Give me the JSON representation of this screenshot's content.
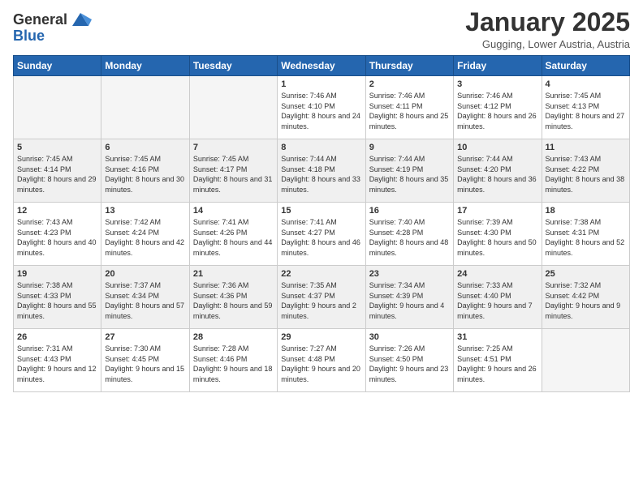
{
  "header": {
    "logo_general": "General",
    "logo_blue": "Blue",
    "month": "January 2025",
    "location": "Gugging, Lower Austria, Austria"
  },
  "weekdays": [
    "Sunday",
    "Monday",
    "Tuesday",
    "Wednesday",
    "Thursday",
    "Friday",
    "Saturday"
  ],
  "weeks": [
    [
      {
        "day": "",
        "info": ""
      },
      {
        "day": "",
        "info": ""
      },
      {
        "day": "",
        "info": ""
      },
      {
        "day": "1",
        "info": "Sunrise: 7:46 AM\nSunset: 4:10 PM\nDaylight: 8 hours and 24 minutes."
      },
      {
        "day": "2",
        "info": "Sunrise: 7:46 AM\nSunset: 4:11 PM\nDaylight: 8 hours and 25 minutes."
      },
      {
        "day": "3",
        "info": "Sunrise: 7:46 AM\nSunset: 4:12 PM\nDaylight: 8 hours and 26 minutes."
      },
      {
        "day": "4",
        "info": "Sunrise: 7:45 AM\nSunset: 4:13 PM\nDaylight: 8 hours and 27 minutes."
      }
    ],
    [
      {
        "day": "5",
        "info": "Sunrise: 7:45 AM\nSunset: 4:14 PM\nDaylight: 8 hours and 29 minutes."
      },
      {
        "day": "6",
        "info": "Sunrise: 7:45 AM\nSunset: 4:16 PM\nDaylight: 8 hours and 30 minutes."
      },
      {
        "day": "7",
        "info": "Sunrise: 7:45 AM\nSunset: 4:17 PM\nDaylight: 8 hours and 31 minutes."
      },
      {
        "day": "8",
        "info": "Sunrise: 7:44 AM\nSunset: 4:18 PM\nDaylight: 8 hours and 33 minutes."
      },
      {
        "day": "9",
        "info": "Sunrise: 7:44 AM\nSunset: 4:19 PM\nDaylight: 8 hours and 35 minutes."
      },
      {
        "day": "10",
        "info": "Sunrise: 7:44 AM\nSunset: 4:20 PM\nDaylight: 8 hours and 36 minutes."
      },
      {
        "day": "11",
        "info": "Sunrise: 7:43 AM\nSunset: 4:22 PM\nDaylight: 8 hours and 38 minutes."
      }
    ],
    [
      {
        "day": "12",
        "info": "Sunrise: 7:43 AM\nSunset: 4:23 PM\nDaylight: 8 hours and 40 minutes."
      },
      {
        "day": "13",
        "info": "Sunrise: 7:42 AM\nSunset: 4:24 PM\nDaylight: 8 hours and 42 minutes."
      },
      {
        "day": "14",
        "info": "Sunrise: 7:41 AM\nSunset: 4:26 PM\nDaylight: 8 hours and 44 minutes."
      },
      {
        "day": "15",
        "info": "Sunrise: 7:41 AM\nSunset: 4:27 PM\nDaylight: 8 hours and 46 minutes."
      },
      {
        "day": "16",
        "info": "Sunrise: 7:40 AM\nSunset: 4:28 PM\nDaylight: 8 hours and 48 minutes."
      },
      {
        "day": "17",
        "info": "Sunrise: 7:39 AM\nSunset: 4:30 PM\nDaylight: 8 hours and 50 minutes."
      },
      {
        "day": "18",
        "info": "Sunrise: 7:38 AM\nSunset: 4:31 PM\nDaylight: 8 hours and 52 minutes."
      }
    ],
    [
      {
        "day": "19",
        "info": "Sunrise: 7:38 AM\nSunset: 4:33 PM\nDaylight: 8 hours and 55 minutes."
      },
      {
        "day": "20",
        "info": "Sunrise: 7:37 AM\nSunset: 4:34 PM\nDaylight: 8 hours and 57 minutes."
      },
      {
        "day": "21",
        "info": "Sunrise: 7:36 AM\nSunset: 4:36 PM\nDaylight: 8 hours and 59 minutes."
      },
      {
        "day": "22",
        "info": "Sunrise: 7:35 AM\nSunset: 4:37 PM\nDaylight: 9 hours and 2 minutes."
      },
      {
        "day": "23",
        "info": "Sunrise: 7:34 AM\nSunset: 4:39 PM\nDaylight: 9 hours and 4 minutes."
      },
      {
        "day": "24",
        "info": "Sunrise: 7:33 AM\nSunset: 4:40 PM\nDaylight: 9 hours and 7 minutes."
      },
      {
        "day": "25",
        "info": "Sunrise: 7:32 AM\nSunset: 4:42 PM\nDaylight: 9 hours and 9 minutes."
      }
    ],
    [
      {
        "day": "26",
        "info": "Sunrise: 7:31 AM\nSunset: 4:43 PM\nDaylight: 9 hours and 12 minutes."
      },
      {
        "day": "27",
        "info": "Sunrise: 7:30 AM\nSunset: 4:45 PM\nDaylight: 9 hours and 15 minutes."
      },
      {
        "day": "28",
        "info": "Sunrise: 7:28 AM\nSunset: 4:46 PM\nDaylight: 9 hours and 18 minutes."
      },
      {
        "day": "29",
        "info": "Sunrise: 7:27 AM\nSunset: 4:48 PM\nDaylight: 9 hours and 20 minutes."
      },
      {
        "day": "30",
        "info": "Sunrise: 7:26 AM\nSunset: 4:50 PM\nDaylight: 9 hours and 23 minutes."
      },
      {
        "day": "31",
        "info": "Sunrise: 7:25 AM\nSunset: 4:51 PM\nDaylight: 9 hours and 26 minutes."
      },
      {
        "day": "",
        "info": ""
      }
    ]
  ]
}
